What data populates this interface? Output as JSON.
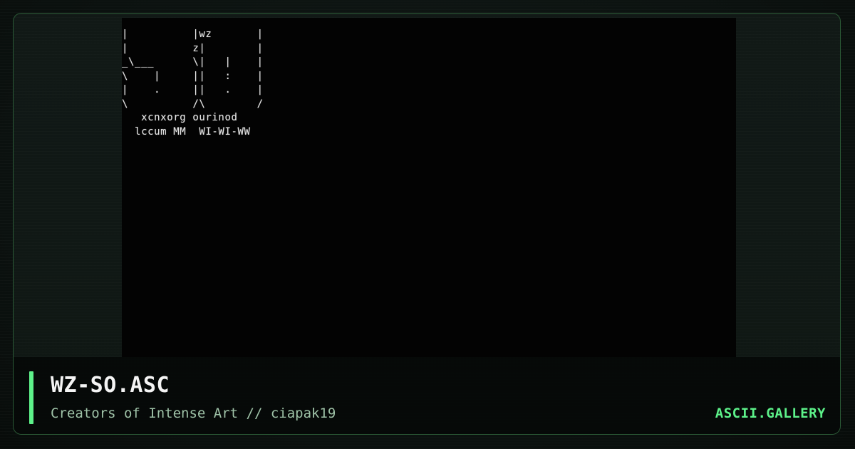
{
  "artwork": {
    "ascii_lines": [
      "|          |wz       |",
      "|          z|        |",
      "_\\___      \\|   |    |",
      "\\    |     ||   :    |",
      "|    .     ||   .    |",
      "\\          /\\        /",
      "   xcnxorg ourinod",
      "  lccum MM  WI-WI-WW"
    ]
  },
  "caption": {
    "title": "WZ-SO.ASC",
    "subtitle": "Creators of Intense Art // ciapak19",
    "brand": "ASCII.GALLERY"
  },
  "colors": {
    "accent": "#5df28a",
    "frame_border": "#2b5a36",
    "art_background": "#030303"
  }
}
